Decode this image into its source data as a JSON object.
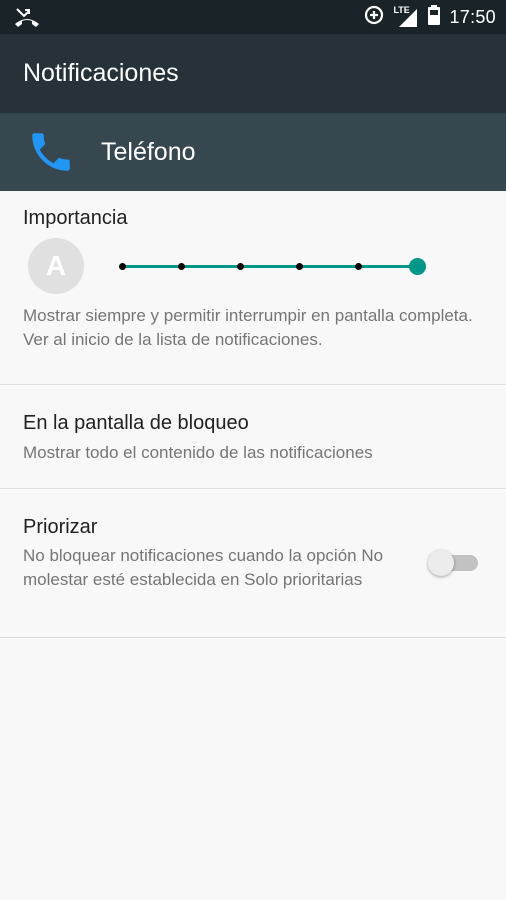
{
  "status_bar": {
    "time": "17:50",
    "network": "LTE",
    "left_icon": "missed-call-icon",
    "icons": [
      "data-saver-icon",
      "signal-lte-icon",
      "battery-icon"
    ]
  },
  "app_bar": {
    "title": "Notificaciones"
  },
  "app_header": {
    "name": "Teléfono",
    "icon": "phone-icon",
    "icon_color": "#2196f3"
  },
  "importance": {
    "title": "Importancia",
    "avatar_letter": "A",
    "level": 5,
    "max_level": 5,
    "description": "Mostrar siempre y permitir interrumpir en pantalla completa. Ver al inicio de la lista de notificaciones."
  },
  "lock_screen": {
    "title": "En la pantalla de bloqueo",
    "subtitle": "Mostrar todo el contenido de las notificaciones"
  },
  "priority": {
    "title": "Priorizar",
    "subtitle": "No bloquear notificaciones cuando la opción No molestar esté establecida en Solo prioritarias",
    "enabled": false
  },
  "colors": {
    "accent": "#009688",
    "toolbar": "#263238",
    "header": "#37474f"
  }
}
